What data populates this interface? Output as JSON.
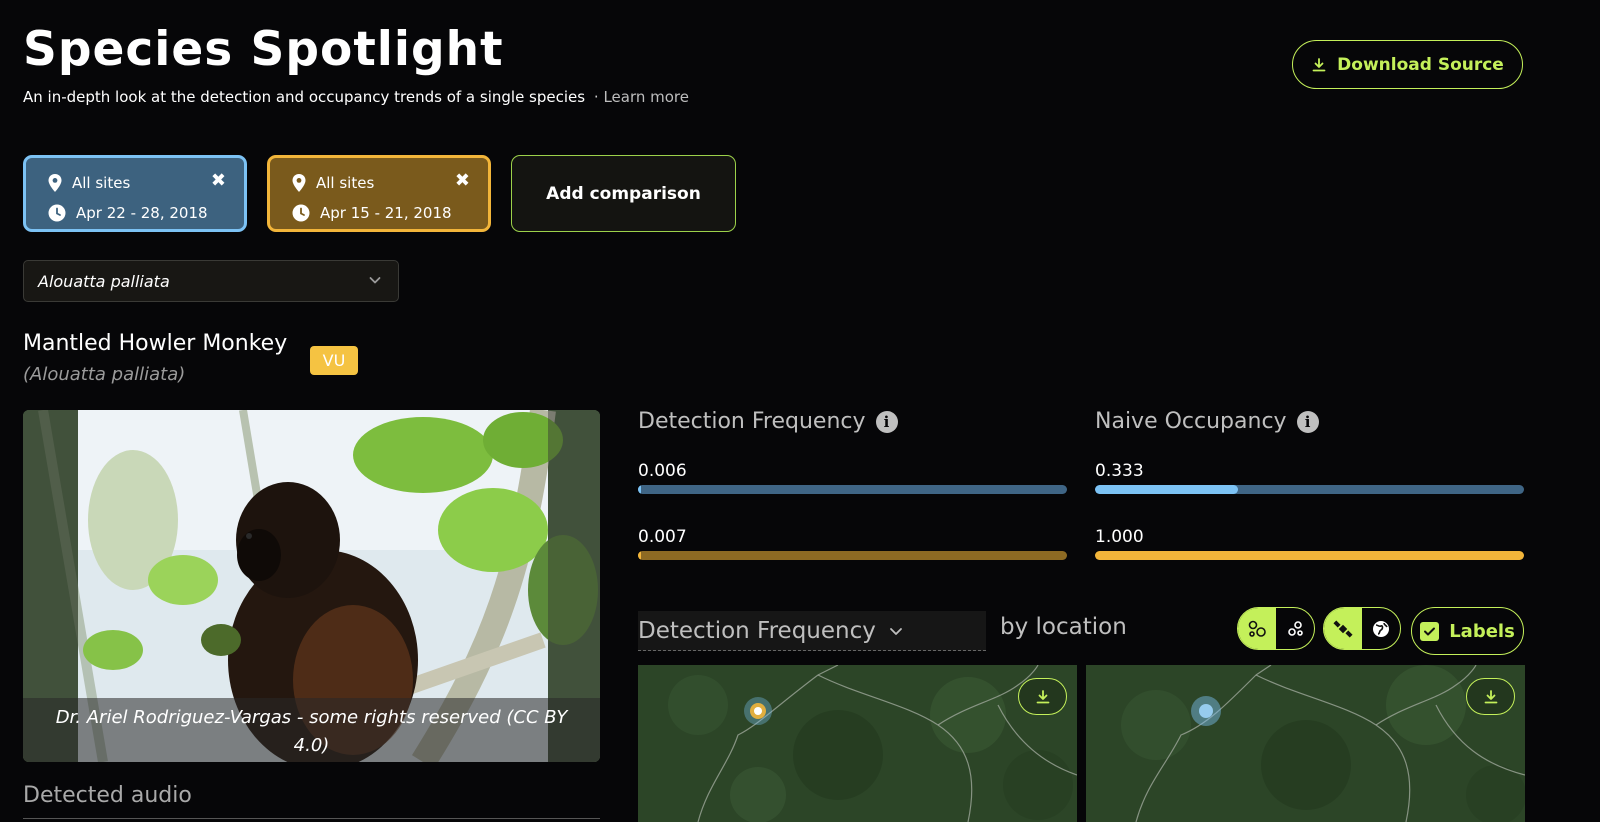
{
  "header": {
    "title": "Species Spotlight",
    "subtitle": "An in-depth look at the detection and occupancy trends of a single species",
    "separator": "·",
    "learn_more": "Learn more",
    "download_label": "Download Source"
  },
  "comparisons": [
    {
      "site": "All sites",
      "date_range": "Apr 22 - 28, 2018",
      "color": "#7cc2f4"
    },
    {
      "site": "All sites",
      "date_range": "Apr 15 - 21, 2018",
      "color": "#f2b53a"
    }
  ],
  "add_comparison_label": "Add comparison",
  "species_select": {
    "value": "Alouatta palliata"
  },
  "species": {
    "common_name": "Mantled Howler Monkey",
    "scientific_name": "(Alouatta palliata)",
    "status_badge": "VU",
    "photo_caption": "Dr. Ariel Rodriguez-Vargas - some rights reserved (CC BY 4.0)"
  },
  "detected_audio_label": "Detected audio",
  "metrics": {
    "detection_frequency": {
      "title": "Detection Frequency",
      "values": [
        {
          "label": "0.006",
          "fraction": 0.006
        },
        {
          "label": "0.007",
          "fraction": 0.007
        }
      ]
    },
    "naive_occupancy": {
      "title": "Naive Occupancy",
      "values": [
        {
          "label": "0.333",
          "fraction": 0.333
        },
        {
          "label": "1.000",
          "fraction": 1.0
        }
      ]
    }
  },
  "map_section": {
    "metric_selected": "Detection Frequency",
    "suffix": "by location",
    "labels_label": "Labels",
    "labels_checked": true
  },
  "colors": {
    "accent": "#c4f05a",
    "blue": "#7cc2f4",
    "gold": "#f2b53a",
    "badge": "#f5c342"
  }
}
